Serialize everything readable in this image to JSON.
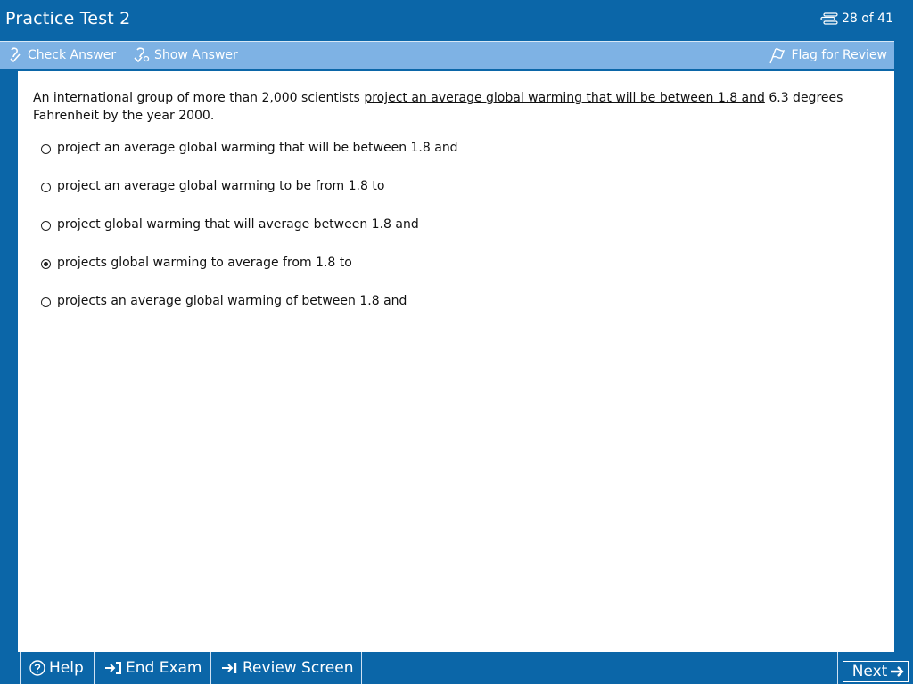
{
  "app": {
    "title": "Practice Test 2"
  },
  "progress": {
    "text": "28 of 41",
    "current": 28,
    "total": 41
  },
  "toolbar": {
    "check_answer": "Check Answer",
    "show_answer": "Show Answer",
    "flag_for_review": "Flag for Review"
  },
  "question": {
    "stem_before": "An international group of more than 2,000 scientists ",
    "stem_underlined": "project an average global warming that will be between 1.8 and",
    "stem_after": " 6.3 degrees Fahrenheit by the year 2000.",
    "selected_index": 3,
    "options": [
      {
        "label": "project an average global warming that will be between 1.8 and"
      },
      {
        "label": "project an average global warming to be from 1.8 to"
      },
      {
        "label": "project global warming that will average between 1.8 and"
      },
      {
        "label": "projects global warming to average from 1.8 to"
      },
      {
        "label": "projects an average global warming of between 1.8 and"
      }
    ]
  },
  "bottombar": {
    "help": "Help",
    "end_exam": "End Exam",
    "review_screen": "Review Screen",
    "next": "Next"
  },
  "colors": {
    "frame_blue": "#0b66a8",
    "toolbar_blue": "#7eb2e4",
    "content_bg": "#ffffff"
  },
  "icons": [
    "progress-list-icon",
    "check-answer-icon",
    "show-answer-icon",
    "flag-icon",
    "help-icon",
    "end-exam-icon",
    "review-screen-icon",
    "next-arrow-icon"
  ]
}
